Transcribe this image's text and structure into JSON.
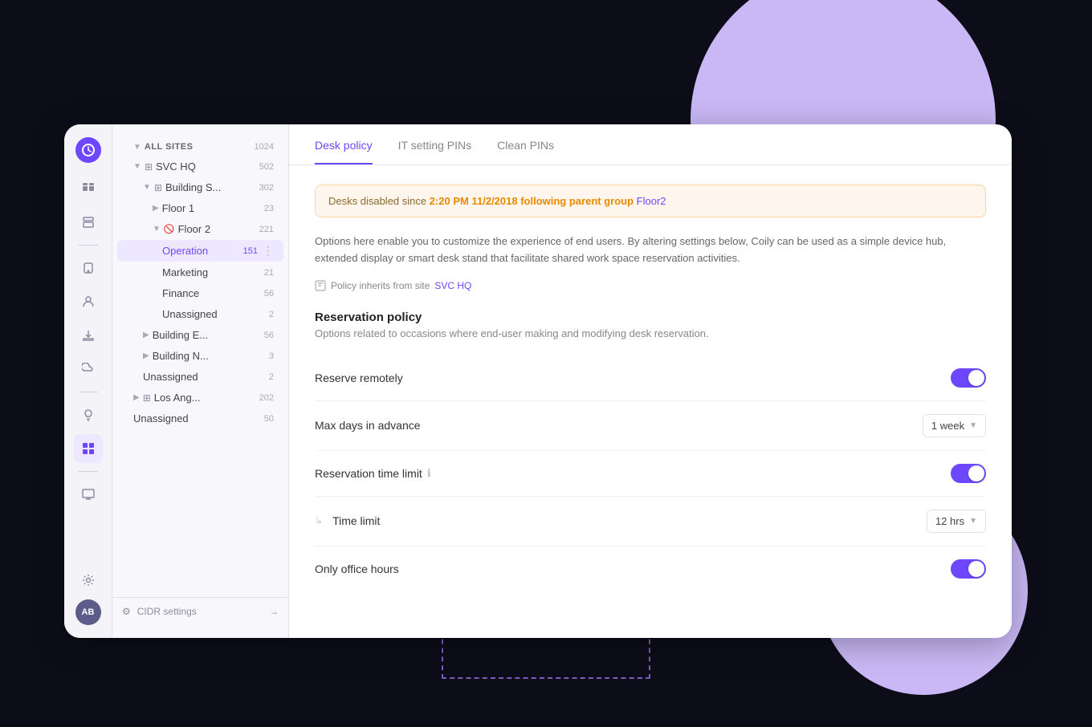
{
  "background": {
    "circle_top_color": "#c9b8f5",
    "circle_bottom_color": "#c9b8f5"
  },
  "sidebar": {
    "logo_text": "⟳",
    "avatar_text": "AB",
    "icons": [
      {
        "name": "home-icon",
        "symbol": "⊞",
        "active": false
      },
      {
        "name": "layers-icon",
        "symbol": "▤",
        "active": false
      },
      {
        "name": "device-icon",
        "symbol": "⛭",
        "active": false
      },
      {
        "name": "user-icon",
        "symbol": "☺",
        "active": false
      },
      {
        "name": "download-icon",
        "symbol": "⬇",
        "active": false
      },
      {
        "name": "cloud-icon",
        "symbol": "☁",
        "active": false
      },
      {
        "name": "lightbulb-icon",
        "symbol": "💡",
        "active": false
      },
      {
        "name": "grid-icon",
        "symbol": "⊞",
        "active": true
      },
      {
        "name": "display-icon",
        "symbol": "▬",
        "active": false
      },
      {
        "name": "settings-icon",
        "symbol": "⚙",
        "active": false
      }
    ]
  },
  "nav": {
    "all_sites_label": "ALL SITES",
    "all_sites_count": "1024",
    "svc_hq_label": "SVC HQ",
    "svc_hq_count": "502",
    "building_s_label": "Building S...",
    "building_s_count": "302",
    "floor1_label": "Floor 1",
    "floor1_count": "23",
    "floor2_label": "Floor 2",
    "floor2_count": "221",
    "operation_label": "Operation",
    "operation_count": "151",
    "marketing_label": "Marketing",
    "marketing_count": "21",
    "finance_label": "Finance",
    "finance_count": "56",
    "unassigned1_label": "Unassigned",
    "unassigned1_count": "2",
    "building_e_label": "Building E...",
    "building_e_count": "56",
    "building_n_label": "Building N...",
    "building_n_count": "3",
    "unassigned2_label": "Unassigned",
    "unassigned2_count": "2",
    "los_ang_label": "Los Ang...",
    "los_ang_count": "202",
    "unassigned3_label": "Unassigned",
    "unassigned3_count": "50",
    "footer_label": "CIDR settings",
    "footer_arrow": "→"
  },
  "tabs": [
    {
      "label": "Desk policy",
      "active": true
    },
    {
      "label": "IT setting PINs",
      "active": false
    },
    {
      "label": "Clean PINs",
      "active": false
    }
  ],
  "warning": {
    "prefix": "Desks disabled since ",
    "highlight": "2:20 PM 11/2/2018 following parent group",
    "link_text": "Floor2"
  },
  "description": "Options here enable you to customize the experience of end users. By altering settings below, Coily can be used as a simple device hub, extended display or smart desk stand that facilitate shared work space reservation activities.",
  "policy_inherit": {
    "prefix": "Policy inherits from site",
    "link": "SVC HQ"
  },
  "reservation_policy": {
    "title": "Reservation policy",
    "subtitle": "Options related to occasions where end-user making and modifying desk reservation.",
    "settings": [
      {
        "id": "reserve-remotely",
        "label": "Reserve remotely",
        "type": "toggle",
        "value": true,
        "has_info": false,
        "indented": false
      },
      {
        "id": "max-days-advance",
        "label": "Max days in advance",
        "type": "dropdown",
        "value": "1 week",
        "has_info": false,
        "indented": false
      },
      {
        "id": "reservation-time-limit",
        "label": "Reservation time limit",
        "type": "toggle",
        "value": true,
        "has_info": true,
        "indented": false
      },
      {
        "id": "time-limit",
        "label": "Time limit",
        "type": "dropdown",
        "value": "12 hrs",
        "has_info": false,
        "indented": true
      },
      {
        "id": "only-office-hours",
        "label": "Only office hours",
        "type": "toggle",
        "value": true,
        "has_info": false,
        "indented": false
      }
    ]
  }
}
